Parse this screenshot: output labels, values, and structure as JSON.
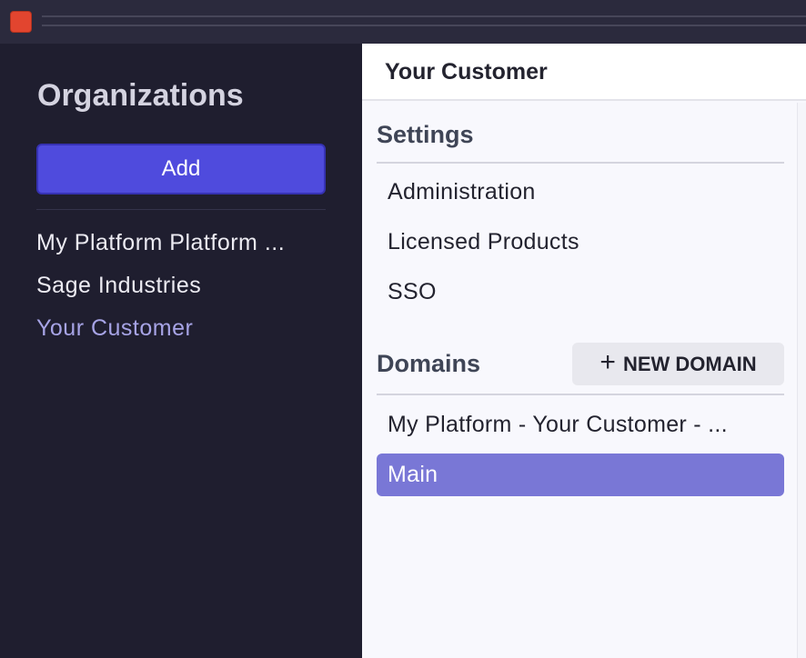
{
  "window": {
    "close_icon": "close-window-icon",
    "close_color": "#e2452f"
  },
  "sidebar": {
    "title": "Organizations",
    "add_label": "Add",
    "items": [
      {
        "label": "My Platform Platform ..."
      },
      {
        "label": "Sage Industries"
      },
      {
        "label": "Your Customer",
        "active": true
      }
    ],
    "colors": {
      "background": "#1f1e2f",
      "accent": "#4f4bdd",
      "active_text": "#a7a4e6"
    }
  },
  "panel": {
    "title": "Your Customer",
    "settings": {
      "heading": "Settings",
      "items": [
        {
          "label": "Administration"
        },
        {
          "label": "Licensed Products"
        },
        {
          "label": "SSO"
        }
      ]
    },
    "domains": {
      "heading": "Domains",
      "new_button": {
        "icon": "plus-icon",
        "label": "NEW DOMAIN"
      },
      "items": [
        {
          "label": "My Platform - Your Customer - ..."
        },
        {
          "label": "Main",
          "selected": true
        }
      ],
      "selected_color": "#7977d6"
    }
  }
}
